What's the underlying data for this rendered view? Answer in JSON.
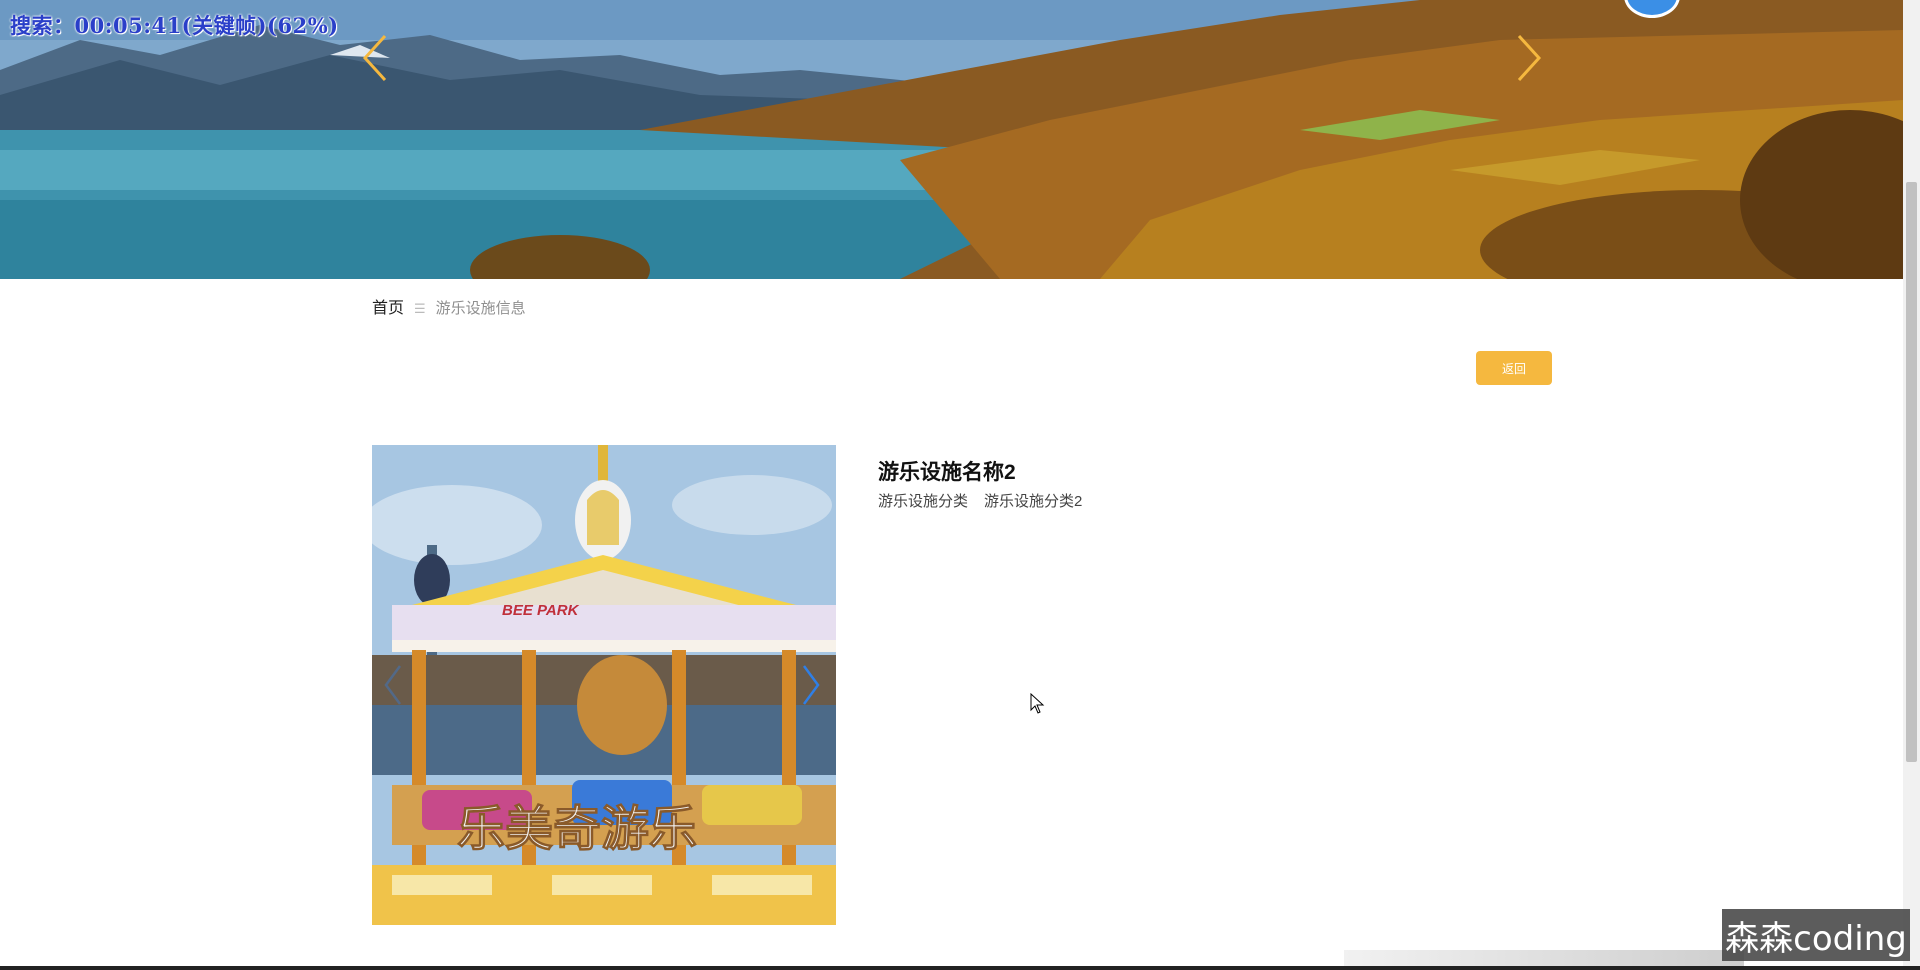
{
  "overlay": {
    "search_text": "搜索：00:05:41(关键帧)(62%)"
  },
  "breadcrumb": {
    "home": "首页",
    "separator": "☰",
    "current": "游乐设施信息"
  },
  "actions": {
    "back_label": "返回"
  },
  "detail": {
    "title": "游乐设施名称2",
    "category_label": "游乐设施分类",
    "category_value": "游乐设施分类2",
    "image_sign_text": "乐美奇游乐",
    "image_banner_text": "BEE PARK"
  },
  "watermark": {
    "text": "森森coding"
  },
  "colors": {
    "accent_button": "#f5b83f",
    "banner_arrow": "#f5b83f",
    "image_arrow": "#2f7fe6"
  },
  "icons": {
    "banner_prev": "chevron-left-icon",
    "banner_next": "chevron-right-icon",
    "image_prev": "chevron-left-icon",
    "image_next": "chevron-right-icon",
    "breadcrumb_separator": "menu-icon"
  }
}
